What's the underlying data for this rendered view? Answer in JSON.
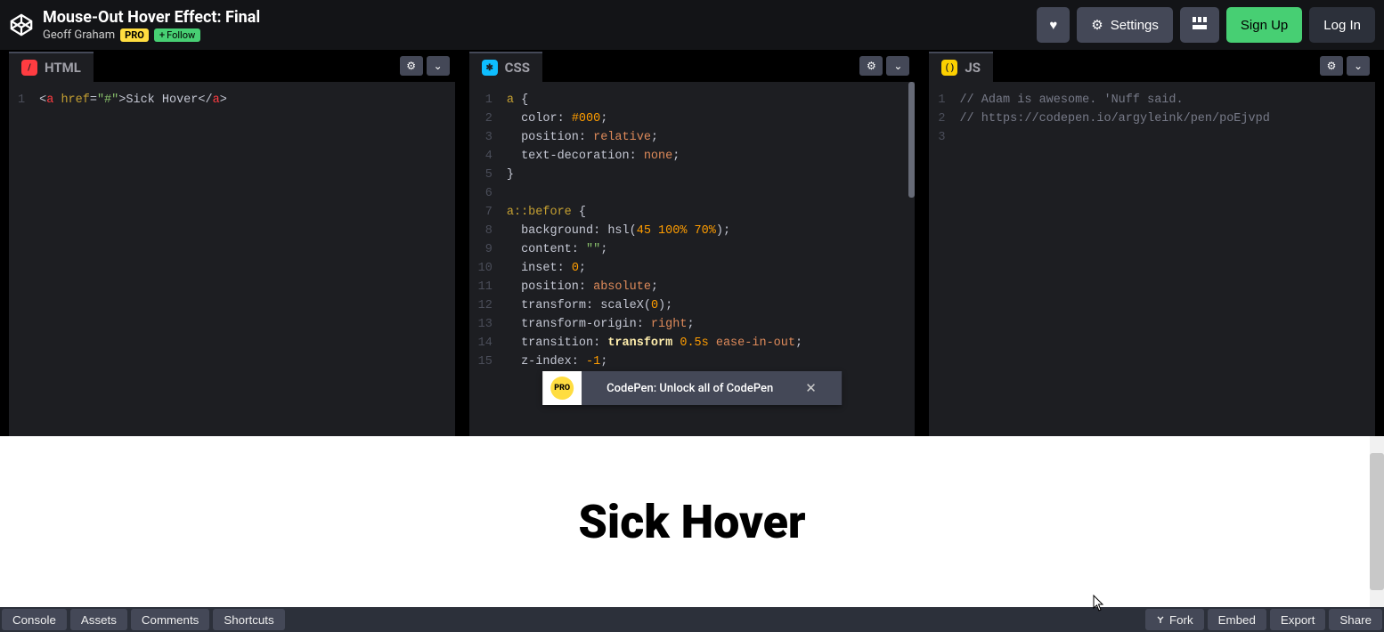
{
  "pen": {
    "title": "Mouse-Out Hover Effect: Final",
    "author": "Geoff Graham",
    "pro": "PRO",
    "follow": "Follow"
  },
  "topbar": {
    "settings": "Settings",
    "signup": "Sign Up",
    "login": "Log In"
  },
  "panes": {
    "html": {
      "label": "HTML",
      "gutter": [
        "1"
      ],
      "code_raw": "<a href=\"#\">Sick Hover</a>"
    },
    "css": {
      "label": "CSS",
      "gutter": [
        "1",
        "2",
        "3",
        "4",
        "5",
        "6",
        "7",
        "8",
        "9",
        "10",
        "11",
        "12",
        "13",
        "14",
        "15"
      ],
      "lines": [
        "a {",
        "  color: #000;",
        "  position: relative;",
        "  text-decoration: none;",
        "}",
        "",
        "a::before {",
        "  background: hsl(45 100% 70%);",
        "  content: \"\";",
        "  inset: 0;",
        "  position: absolute;",
        "  transform: scaleX(0);",
        "  transform-origin: right;",
        "  transition: transform 0.5s ease-in-out;",
        "  z-index: -1;"
      ]
    },
    "js": {
      "label": "JS",
      "gutter": [
        "1",
        "2",
        "3"
      ],
      "lines": [
        "// Adam is awesome. 'Nuff said.",
        "// https://codepen.io/argyleink/pen/poEjvpd",
        ""
      ]
    }
  },
  "banner": {
    "badge": "PRO",
    "text": "CodePen: Unlock all of CodePen"
  },
  "preview": {
    "link_text": "Sick Hover"
  },
  "footer": {
    "console": "Console",
    "assets": "Assets",
    "comments": "Comments",
    "shortcuts": "Shortcuts",
    "fork": "Fork",
    "embed": "Embed",
    "export": "Export",
    "share": "Share"
  }
}
